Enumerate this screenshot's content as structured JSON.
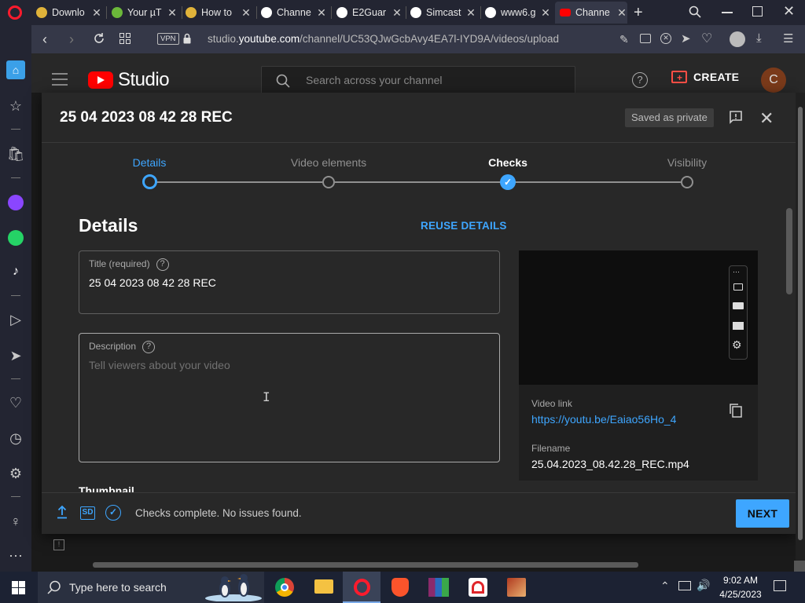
{
  "browser": {
    "tabs": [
      {
        "label": "Downlo",
        "color": "#e0b33a"
      },
      {
        "label": "Your µT",
        "color": "#6bb83a"
      },
      {
        "label": "How to",
        "color": "#e0b33a"
      },
      {
        "label": "Channe",
        "color": "#ffffff"
      },
      {
        "label": "E2Guar",
        "color": "#ffffff"
      },
      {
        "label": "Simcast",
        "color": "#ffffff"
      },
      {
        "label": "www6.g",
        "color": "#ffffff"
      },
      {
        "label": "Channe",
        "color": "#ff0000"
      }
    ],
    "url_domain": "studio.youtube.com",
    "url_path": "/channel/UC53QJwGcbAvy4EA7l-IYD9A/videos/upload",
    "url_prefix": "studio.",
    "url_host": "youtube.com",
    "vpn_label": "VPN"
  },
  "studio": {
    "logo_text": "Studio",
    "search_placeholder": "Search across your channel",
    "create_label": "CREATE",
    "avatar_letter": "C"
  },
  "dialog": {
    "title": "25 04 2023 08 42 28 REC",
    "saved_badge": "Saved as private",
    "steps": [
      "Details",
      "Video elements",
      "Checks",
      "Visibility"
    ],
    "section_title": "Details",
    "reuse_label": "REUSE DETAILS",
    "title_field_label": "Title (required)",
    "title_field_value": "25 04 2023 08 42 28 REC",
    "desc_field_label": "Description",
    "desc_placeholder": "Tell viewers about your video",
    "thumbnail_label": "Thumbnail",
    "video_link_label": "Video link",
    "video_link": "https://youtu.be/Eaiao56Ho_4",
    "filename_label": "Filename",
    "filename": "25.04.2023_08.42.28_REC.mp4",
    "footer_sd": "SD",
    "footer_status": "Checks complete. No issues found.",
    "next_label": "NEXT",
    "help_char": "?"
  },
  "taskbar": {
    "search_placeholder": "Type here to search",
    "time": "9:02 AM",
    "date": "4/25/2023"
  },
  "colors": {
    "accent_blue": "#3ea6ff",
    "next_bg": "#3ea6ff",
    "yt_red": "#ff0000"
  }
}
